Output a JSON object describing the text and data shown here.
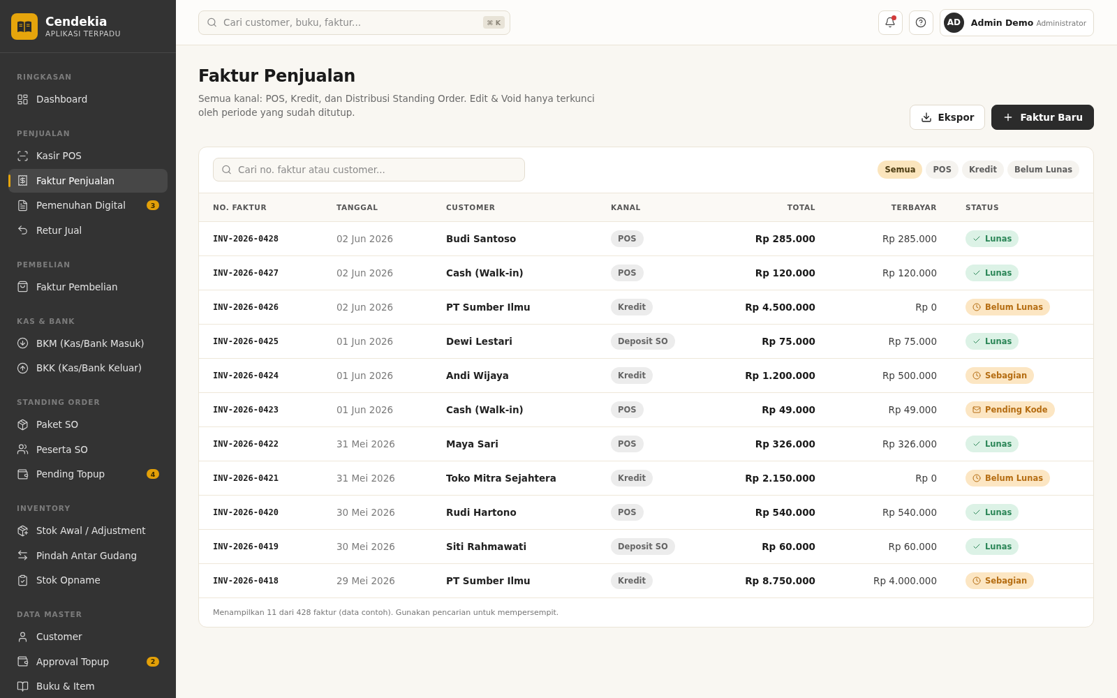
{
  "sidebar": {
    "brand": {
      "name": "Cendekia",
      "tagline": "APLIKASI TERPADU"
    },
    "sections": [
      {
        "title": "RINGKASAN",
        "items": [
          {
            "label": "Dashboard",
            "selected": false
          }
        ]
      },
      {
        "title": "PENJUALAN",
        "items": [
          {
            "label": "Kasir POS",
            "selected": false
          },
          {
            "label": "Faktur Penjualan",
            "selected": true
          },
          {
            "label": "Pemenuhan Digital",
            "selected": false,
            "badge": "3"
          },
          {
            "label": "Retur Jual",
            "selected": false
          }
        ]
      },
      {
        "title": "PEMBELIAN",
        "items": [
          {
            "label": "Faktur Pembelian",
            "selected": false
          }
        ]
      },
      {
        "title": "KAS & BANK",
        "items": [
          {
            "label": "BKM (Kas/Bank Masuk)",
            "selected": false
          },
          {
            "label": "BKK (Kas/Bank Keluar)",
            "selected": false
          }
        ]
      },
      {
        "title": "STANDING ORDER",
        "items": [
          {
            "label": "Paket SO",
            "selected": false
          },
          {
            "label": "Peserta SO",
            "selected": false
          },
          {
            "label": "Pending Topup",
            "selected": false,
            "badge": "4"
          }
        ]
      },
      {
        "title": "INVENTORY",
        "items": [
          {
            "label": "Stok Awal / Adjustment",
            "selected": false
          },
          {
            "label": "Pindah Antar Gudang",
            "selected": false
          },
          {
            "label": "Stok Opname",
            "selected": false
          }
        ]
      },
      {
        "title": "DATA MASTER",
        "items": [
          {
            "label": "Customer",
            "selected": false
          },
          {
            "label": "Approval Topup",
            "selected": false,
            "badge": "2"
          },
          {
            "label": "Buku & Item",
            "selected": false
          }
        ]
      }
    ]
  },
  "header": {
    "search": {
      "placeholder": "Cari customer, buku, faktur...",
      "shortcut": "⌘ K"
    },
    "notifications": {
      "unread": true
    },
    "user": {
      "initials": "AD",
      "name": "Admin Demo",
      "role": "Administrator"
    }
  },
  "page": {
    "title": "Faktur Penjualan",
    "description": "Semua kanal: POS, Kredit, dan Distribusi Standing Order. Edit & Void hanya terkunci oleh periode yang sudah ditutup.",
    "actions": [
      {
        "label": "Ekspor",
        "kind": "secondary"
      },
      {
        "label": "Faktur Baru",
        "kind": "primary"
      }
    ]
  },
  "invoices": {
    "search": {
      "placeholder": "Cari no. faktur atau customer..."
    },
    "filters": [
      {
        "label": "Semua",
        "selected": true
      },
      {
        "label": "POS",
        "selected": false
      },
      {
        "label": "Kredit",
        "selected": false
      },
      {
        "label": "Belum Lunas",
        "selected": false
      }
    ],
    "columns": [
      "NO. FAKTUR",
      "TANGGAL",
      "CUSTOMER",
      "KANAL",
      "TOTAL",
      "TERBAYAR",
      "STATUS"
    ],
    "rows": [
      {
        "number": "INV-2026-0428",
        "date": "02 Jun 2026",
        "customer": "Budi Santoso",
        "channel": "POS",
        "total": "Rp 285.000",
        "paid": "Rp 285.000",
        "status": {
          "label": "Lunas",
          "kind": "paid"
        }
      },
      {
        "number": "INV-2026-0427",
        "date": "02 Jun 2026",
        "customer": "Cash (Walk-in)",
        "channel": "POS",
        "total": "Rp 120.000",
        "paid": "Rp 120.000",
        "status": {
          "label": "Lunas",
          "kind": "paid"
        }
      },
      {
        "number": "INV-2026-0426",
        "date": "02 Jun 2026",
        "customer": "PT Sumber Ilmu",
        "channel": "Kredit",
        "total": "Rp 4.500.000",
        "paid": "Rp 0",
        "status": {
          "label": "Belum Lunas",
          "kind": "unpaid"
        }
      },
      {
        "number": "INV-2026-0425",
        "date": "01 Jun 2026",
        "customer": "Dewi Lestari",
        "channel": "Deposit SO",
        "total": "Rp 75.000",
        "paid": "Rp 75.000",
        "status": {
          "label": "Lunas",
          "kind": "paid"
        }
      },
      {
        "number": "INV-2026-0424",
        "date": "01 Jun 2026",
        "customer": "Andi Wijaya",
        "channel": "Kredit",
        "total": "Rp 1.200.000",
        "paid": "Rp 500.000",
        "status": {
          "label": "Sebagian",
          "kind": "partial"
        }
      },
      {
        "number": "INV-2026-0423",
        "date": "01 Jun 2026",
        "customer": "Cash (Walk-in)",
        "channel": "POS",
        "total": "Rp 49.000",
        "paid": "Rp 49.000",
        "status": {
          "label": "Pending Kode",
          "kind": "pending"
        }
      },
      {
        "number": "INV-2026-0422",
        "date": "31 Mei 2026",
        "customer": "Maya Sari",
        "channel": "POS",
        "total": "Rp 326.000",
        "paid": "Rp 326.000",
        "status": {
          "label": "Lunas",
          "kind": "paid"
        }
      },
      {
        "number": "INV-2026-0421",
        "date": "31 Mei 2026",
        "customer": "Toko Mitra Sejahtera",
        "channel": "Kredit",
        "total": "Rp 2.150.000",
        "paid": "Rp 0",
        "status": {
          "label": "Belum Lunas",
          "kind": "unpaid"
        }
      },
      {
        "number": "INV-2026-0420",
        "date": "30 Mei 2026",
        "customer": "Rudi Hartono",
        "channel": "POS",
        "total": "Rp 540.000",
        "paid": "Rp 540.000",
        "status": {
          "label": "Lunas",
          "kind": "paid"
        }
      },
      {
        "number": "INV-2026-0419",
        "date": "30 Mei 2026",
        "customer": "Siti Rahmawati",
        "channel": "Deposit SO",
        "total": "Rp 60.000",
        "paid": "Rp 60.000",
        "status": {
          "label": "Lunas",
          "kind": "paid"
        }
      },
      {
        "number": "INV-2026-0418",
        "date": "29 Mei 2026",
        "customer": "PT Sumber Ilmu",
        "channel": "Kredit",
        "total": "Rp 8.750.000",
        "paid": "Rp 4.000.000",
        "status": {
          "label": "Sebagian",
          "kind": "partial"
        }
      }
    ],
    "footer": "Menampilkan 11 dari 428 faktur (data contoh). Gunakan pencarian untuk mempersempit."
  }
}
